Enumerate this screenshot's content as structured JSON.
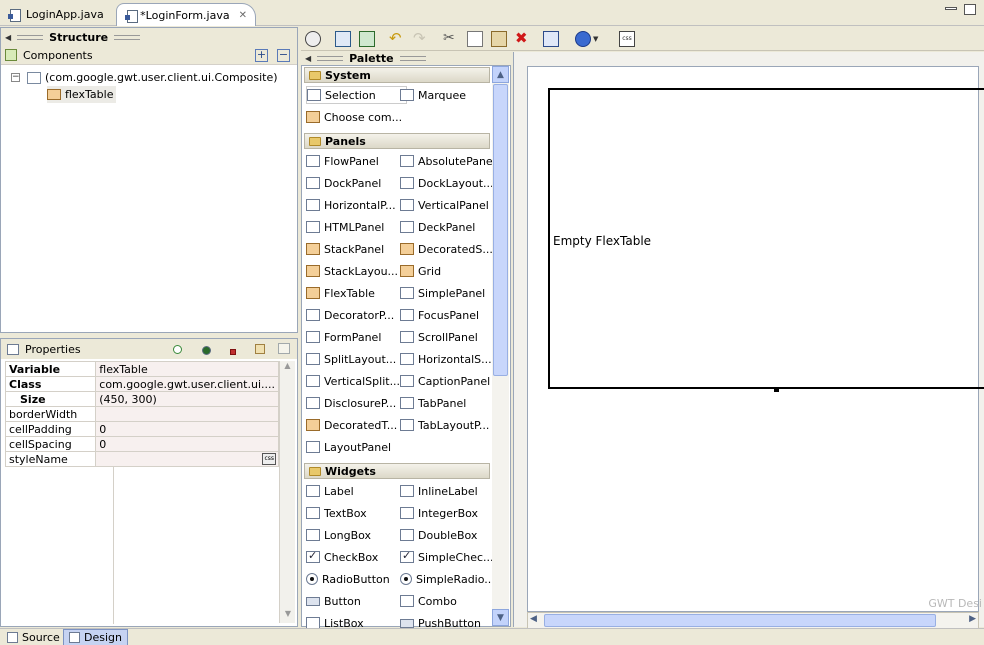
{
  "editor_tabs": [
    {
      "label": "LoginApp.java"
    },
    {
      "label": "*LoginForm.java"
    }
  ],
  "structure": {
    "title": "Structure",
    "components_label": "Components",
    "tree": [
      {
        "label": "(com.google.gwt.user.client.ui.Composite)"
      },
      {
        "label": "flexTable"
      }
    ]
  },
  "properties": {
    "title": "Properties",
    "rows": [
      {
        "key": "Variable",
        "value": "flexTable",
        "bold": true
      },
      {
        "key": "Class",
        "value": "com.google.gwt.user.client.ui....",
        "bold": true
      },
      {
        "key": "Size",
        "value": "(450, 300)",
        "bold": true
      },
      {
        "key": "borderWidth",
        "value": ""
      },
      {
        "key": "cellPadding",
        "value": "0"
      },
      {
        "key": "cellSpacing",
        "value": "0"
      },
      {
        "key": "styleName",
        "value": "",
        "css_badge": "css"
      }
    ]
  },
  "palette": {
    "title": "Palette",
    "categories": [
      {
        "name": "System",
        "items": [
          "Selection",
          "Marquee",
          "Choose com..."
        ]
      },
      {
        "name": "Panels",
        "items": [
          "FlowPanel",
          "AbsolutePanel",
          "DockPanel",
          "DockLayout...",
          "HorizontalP...",
          "VerticalPanel",
          "HTMLPanel",
          "DeckPanel",
          "StackPanel",
          "DecoratedS...",
          "StackLayou...",
          "Grid",
          "FlexTable",
          "SimplePanel",
          "DecoratorP...",
          "FocusPanel",
          "FormPanel",
          "ScrollPanel",
          "SplitLayout...",
          "HorizontalS...",
          "VerticalSplit...",
          "CaptionPanel",
          "DisclosureP...",
          "TabPanel",
          "DecoratedT...",
          "TabLayoutP...",
          "LayoutPanel"
        ]
      },
      {
        "name": "Widgets",
        "items": [
          "Label",
          "InlineLabel",
          "TextBox",
          "IntegerBox",
          "LongBox",
          "DoubleBox",
          "CheckBox",
          "SimpleChec...",
          "RadioButton",
          "SimpleRadio...",
          "Button",
          "Combo",
          "ListBox",
          "PushButton"
        ]
      }
    ]
  },
  "canvas": {
    "widget_label": "Empty FlexTable",
    "watermark": "GWT Desi"
  },
  "bottom_tabs": [
    {
      "label": "Source"
    },
    {
      "label": "Design"
    }
  ]
}
